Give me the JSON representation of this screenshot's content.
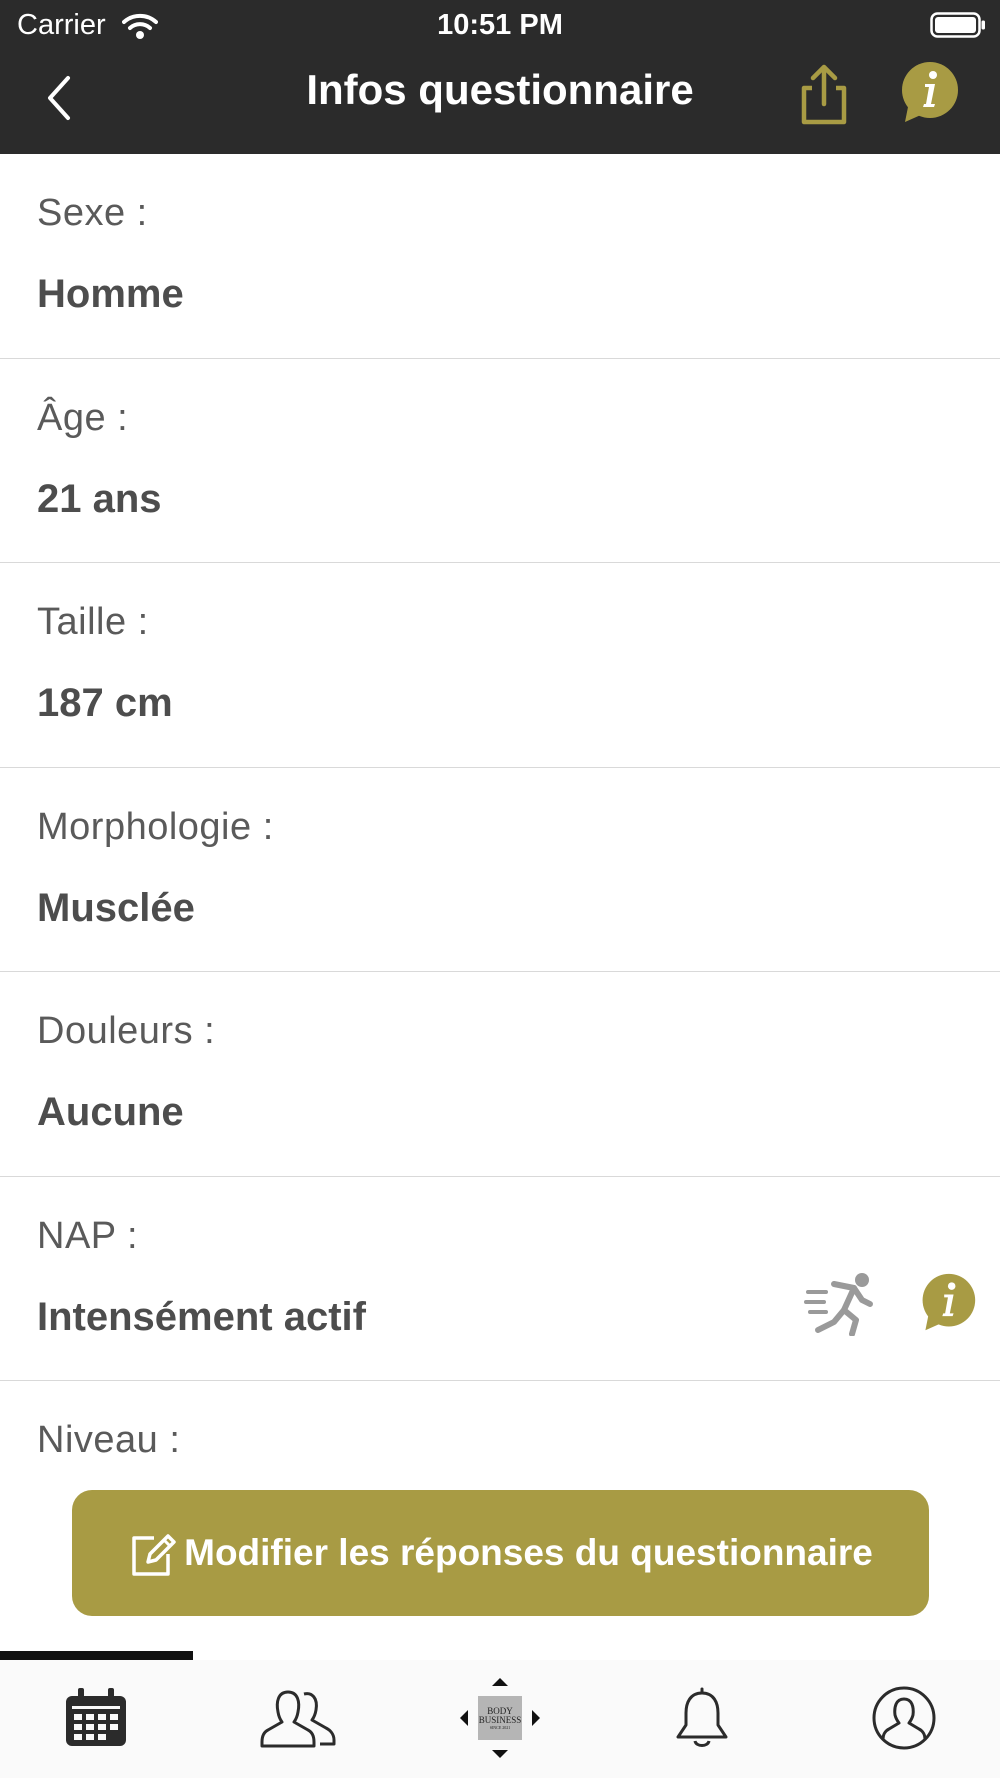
{
  "status_bar": {
    "carrier": "Carrier",
    "time": "10:51 PM"
  },
  "nav": {
    "title": "Infos questionnaire"
  },
  "rows": [
    {
      "label": "Sexe :",
      "value": "Homme"
    },
    {
      "label": "Âge :",
      "value": "21 ans"
    },
    {
      "label": "Taille :",
      "value": "187 cm"
    },
    {
      "label": "Morphologie :",
      "value": "Musclée"
    },
    {
      "label": "Douleurs :",
      "value": "Aucune"
    },
    {
      "label": "NAP :",
      "value": "Intensément actif"
    },
    {
      "label": "Niveau :",
      "value": ""
    }
  ],
  "modify_button": {
    "label": "Modifier les réponses du questionnaire"
  },
  "tabs": [
    {
      "icon": "calendar-icon"
    },
    {
      "icon": "people-icon"
    },
    {
      "icon": "body-business-logo",
      "logo_text": [
        "BODY",
        "BUSINESS",
        "SINCE 2021"
      ]
    },
    {
      "icon": "bell-icon"
    },
    {
      "icon": "profile-icon"
    }
  ],
  "colors": {
    "header_bg": "#2b2b2b",
    "accent": "#a89b44",
    "text": "#4d4d4d",
    "icon_gray": "#9a9a9a"
  }
}
